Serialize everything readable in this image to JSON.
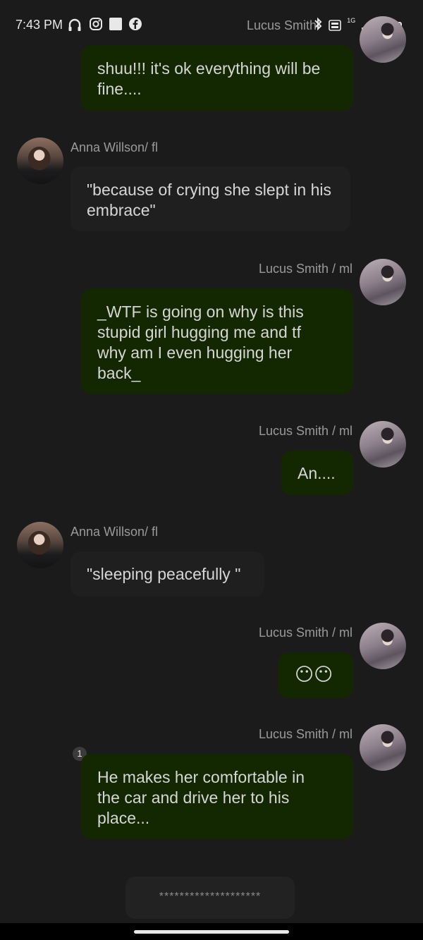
{
  "status_bar": {
    "time": "7:43 PM",
    "left_icons": [
      "headphones-icon",
      "instagram-icon",
      "square-app-icon",
      "facebook-icon"
    ],
    "right_icons": [
      "bluetooth-icon",
      "volte-icon",
      "signal-icon",
      "battery-icon"
    ],
    "network_label": "1G"
  },
  "messages": [
    {
      "sender": "Lucus Smith",
      "side": "me",
      "text": "shuu!!! it's ok everything will be fine...."
    },
    {
      "sender": "Anna Willson/ fl",
      "side": "them",
      "text": "\"because of crying she slept in his embrace\""
    },
    {
      "sender": "Lucus Smith / ml",
      "side": "me",
      "text": "_WTF is going on why is this stupid girl hugging me and tf why am I even hugging her back_"
    },
    {
      "sender": "Lucus Smith / ml",
      "side": "me",
      "text": "An...."
    },
    {
      "sender": "Anna Willson/ fl",
      "side": "them",
      "text": "\"sleeping peacefully \""
    },
    {
      "sender": "Lucus Smith / ml",
      "side": "me",
      "text": "😶😶"
    },
    {
      "sender": "Lucus Smith / ml",
      "side": "me",
      "text": "He makes her comfortable in the car and drive her to his place...",
      "badge": "1"
    }
  ],
  "input": {
    "text": "********************"
  },
  "colors": {
    "background": "#1b1b1b",
    "my_bubble": "#132700",
    "their_bubble": "#1f1f1f"
  }
}
